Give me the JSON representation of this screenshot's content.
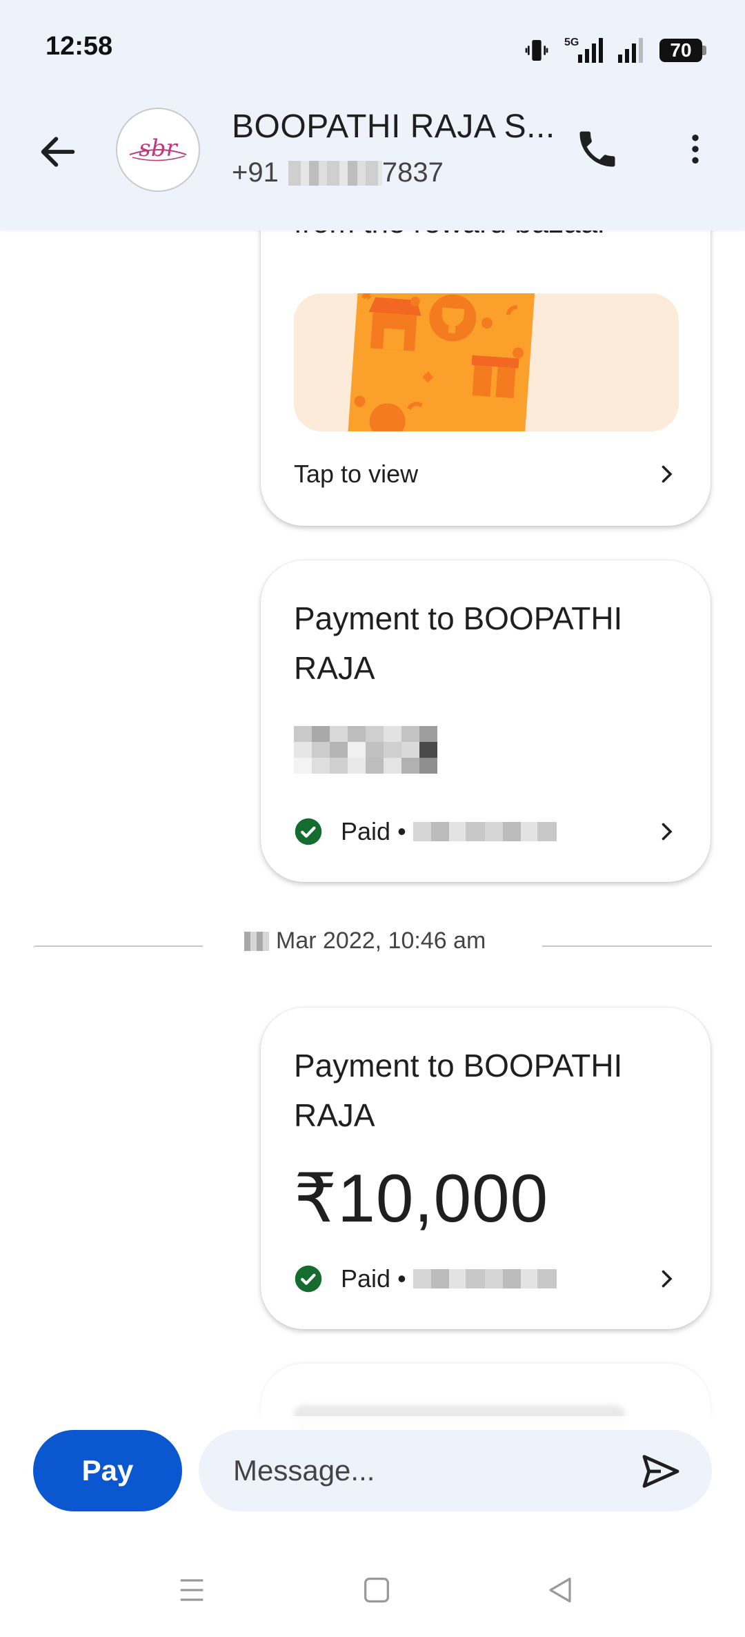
{
  "status_bar": {
    "time": "12:58",
    "network_label": "5G",
    "battery": "70"
  },
  "header": {
    "contact_name": "BOOPATHI RAJA S...",
    "phone_prefix": "+91",
    "phone_suffix": "7837",
    "avatar_monogram": "sbr"
  },
  "messages": {
    "reward_card": {
      "cut_text": "from the reward bazaar",
      "tap_label": "Tap to view"
    },
    "payment_1": {
      "title": "Payment to BOOPATHI RAJA",
      "status": "Paid",
      "separator": "•"
    },
    "date_separator": "Mar 2022, 10:46 am",
    "payment_2": {
      "title": "Payment to BOOPATHI RAJA",
      "amount": "₹10,000",
      "status": "Paid",
      "separator": "•"
    }
  },
  "composer": {
    "pay_label": "Pay",
    "message_placeholder": "Message..."
  },
  "colors": {
    "accent": "#0b57d0",
    "header_bg": "#eef2fb",
    "paid_green": "#146c2e",
    "reward_orange": "#fba02a"
  }
}
